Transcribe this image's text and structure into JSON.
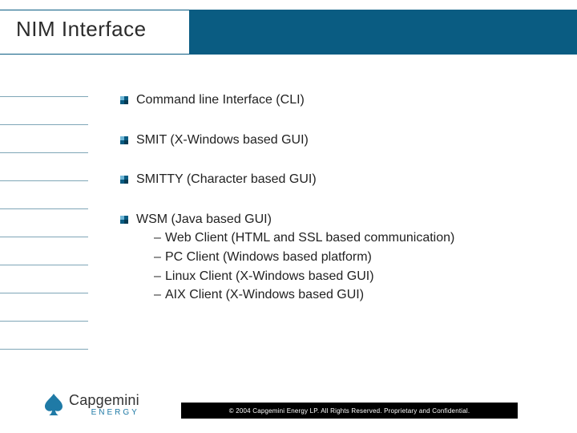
{
  "title": "NIM Interface",
  "bullets": [
    {
      "text": "Command line Interface (CLI)"
    },
    {
      "text": "SMIT (X-Windows based GUI)"
    },
    {
      "text": "SMITTY (Character based GUI)"
    },
    {
      "text": "WSM (Java based GUI)",
      "subs": [
        "Web Client (HTML and SSL based communication)",
        "PC Client (Windows based platform)",
        "Linux Client (X-Windows based GUI)",
        "AIX Client (X-Windows based GUI)"
      ]
    }
  ],
  "logo": {
    "brand_a": "Capgemini",
    "sub": "ENERGY"
  },
  "footer_copyright": "© 2004 Capgemini Energy LP. All Rights Reserved. Proprietary and Confidential.",
  "colors": {
    "brand_blue": "#0a5c82"
  }
}
